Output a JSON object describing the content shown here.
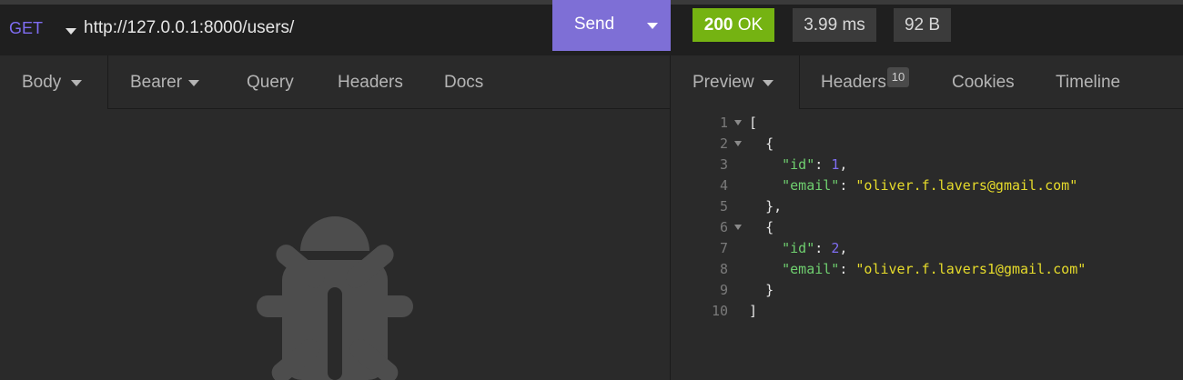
{
  "request": {
    "method": "GET",
    "url": "http://127.0.0.1:8000/users/",
    "send_label": "Send"
  },
  "response": {
    "status_code": "200",
    "status_text": "OK",
    "time": "3.99 ms",
    "size": "92 B"
  },
  "request_tabs": [
    "Body",
    "Bearer",
    "Query",
    "Headers",
    "Docs"
  ],
  "response_tabs": [
    "Preview",
    "Headers",
    "Cookies",
    "Timeline"
  ],
  "response_headers_count": "10",
  "preview": {
    "lines": [
      {
        "n": "1",
        "fold": true,
        "indent": "",
        "parts": [
          {
            "t": "[",
            "c": "p"
          }
        ]
      },
      {
        "n": "2",
        "fold": true,
        "indent": "  ",
        "parts": [
          {
            "t": "{",
            "c": "p"
          }
        ]
      },
      {
        "n": "3",
        "fold": false,
        "indent": "    ",
        "parts": [
          {
            "t": "\"id\"",
            "c": "k"
          },
          {
            "t": ": ",
            "c": "p"
          },
          {
            "t": "1",
            "c": "n"
          },
          {
            "t": ",",
            "c": "p"
          }
        ]
      },
      {
        "n": "4",
        "fold": false,
        "indent": "    ",
        "parts": [
          {
            "t": "\"email\"",
            "c": "k"
          },
          {
            "t": ": ",
            "c": "p"
          },
          {
            "t": "\"oliver.f.lavers@gmail.com\"",
            "c": "s"
          }
        ]
      },
      {
        "n": "5",
        "fold": false,
        "indent": "  ",
        "parts": [
          {
            "t": "},",
            "c": "p"
          }
        ]
      },
      {
        "n": "6",
        "fold": true,
        "indent": "  ",
        "parts": [
          {
            "t": "{",
            "c": "p"
          }
        ]
      },
      {
        "n": "7",
        "fold": false,
        "indent": "    ",
        "parts": [
          {
            "t": "\"id\"",
            "c": "k"
          },
          {
            "t": ": ",
            "c": "p"
          },
          {
            "t": "2",
            "c": "n"
          },
          {
            "t": ",",
            "c": "p"
          }
        ]
      },
      {
        "n": "8",
        "fold": false,
        "indent": "    ",
        "parts": [
          {
            "t": "\"email\"",
            "c": "k"
          },
          {
            "t": ": ",
            "c": "p"
          },
          {
            "t": "\"oliver.f.lavers1@gmail.com\"",
            "c": "s"
          }
        ]
      },
      {
        "n": "9",
        "fold": false,
        "indent": "  ",
        "parts": [
          {
            "t": "}",
            "c": "p"
          }
        ]
      },
      {
        "n": "10",
        "fold": false,
        "indent": "",
        "parts": [
          {
            "t": "]",
            "c": "p"
          }
        ]
      }
    ]
  },
  "empty_state_icon": "bug-icon",
  "colors": {
    "accent": "#7e6fd6",
    "status_ok": "#75b312",
    "json_key": "#6fcf6f",
    "json_string": "#e6db2b",
    "json_number": "#7f6df2"
  }
}
